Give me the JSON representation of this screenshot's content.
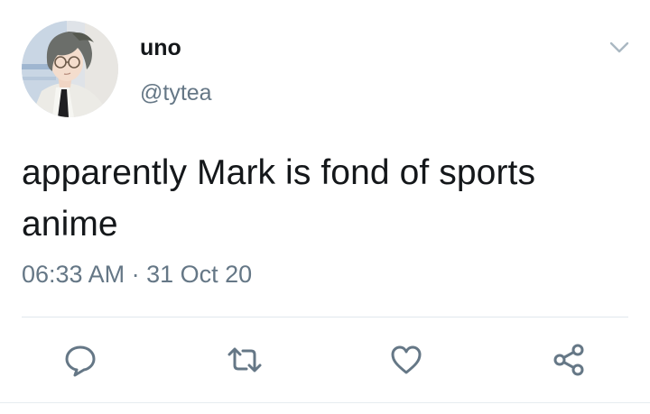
{
  "user": {
    "display_name": "uno",
    "handle": "@tytea"
  },
  "tweet": {
    "text": "apparently Mark is fond of sports anime",
    "timestamp": "06:33 AM · 31 Oct 20"
  },
  "icons": {
    "avatar": "anime-avatar-image",
    "menu": "chevron-down-icon",
    "reply": "reply-icon",
    "retweet": "retweet-icon",
    "like": "heart-icon",
    "share": "share-icon"
  },
  "colors": {
    "text": "#14171a",
    "secondary": "#657786",
    "icon": "#657786",
    "divider": "#e1e8ed"
  }
}
